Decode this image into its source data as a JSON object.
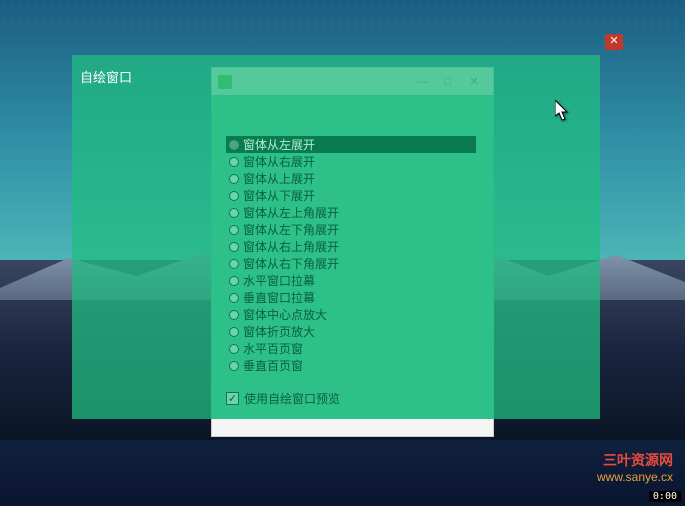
{
  "desktop": {
    "close_glyph": "✕"
  },
  "overlay": {
    "title": "自绘窗口"
  },
  "inner": {
    "minimize_glyph": "—",
    "maximize_glyph": "□",
    "close_glyph": "✕"
  },
  "options": {
    "items": [
      {
        "label": "窗体从左展开",
        "selected": true
      },
      {
        "label": "窗体从右展开",
        "selected": false
      },
      {
        "label": "窗体从上展开",
        "selected": false
      },
      {
        "label": "窗体从下展开",
        "selected": false
      },
      {
        "label": "窗体从左上角展开",
        "selected": false
      },
      {
        "label": "窗体从左下角展开",
        "selected": false
      },
      {
        "label": "窗体从右上角展开",
        "selected": false
      },
      {
        "label": "窗体从右下角展开",
        "selected": false
      },
      {
        "label": "水平窗口拉幕",
        "selected": false
      },
      {
        "label": "垂直窗口拉幕",
        "selected": false
      },
      {
        "label": "窗体中心点放大",
        "selected": false
      },
      {
        "label": "窗体折页放大",
        "selected": false
      },
      {
        "label": "水平百页窗",
        "selected": false
      },
      {
        "label": "垂直百页窗",
        "selected": false
      }
    ]
  },
  "checkbox": {
    "label": "使用自绘窗口预览",
    "checked": true,
    "mark": "✓"
  },
  "watermark": {
    "line1": "三叶资源网",
    "line2": "www.sanye.cx"
  },
  "timer": {
    "value": "0:00"
  }
}
